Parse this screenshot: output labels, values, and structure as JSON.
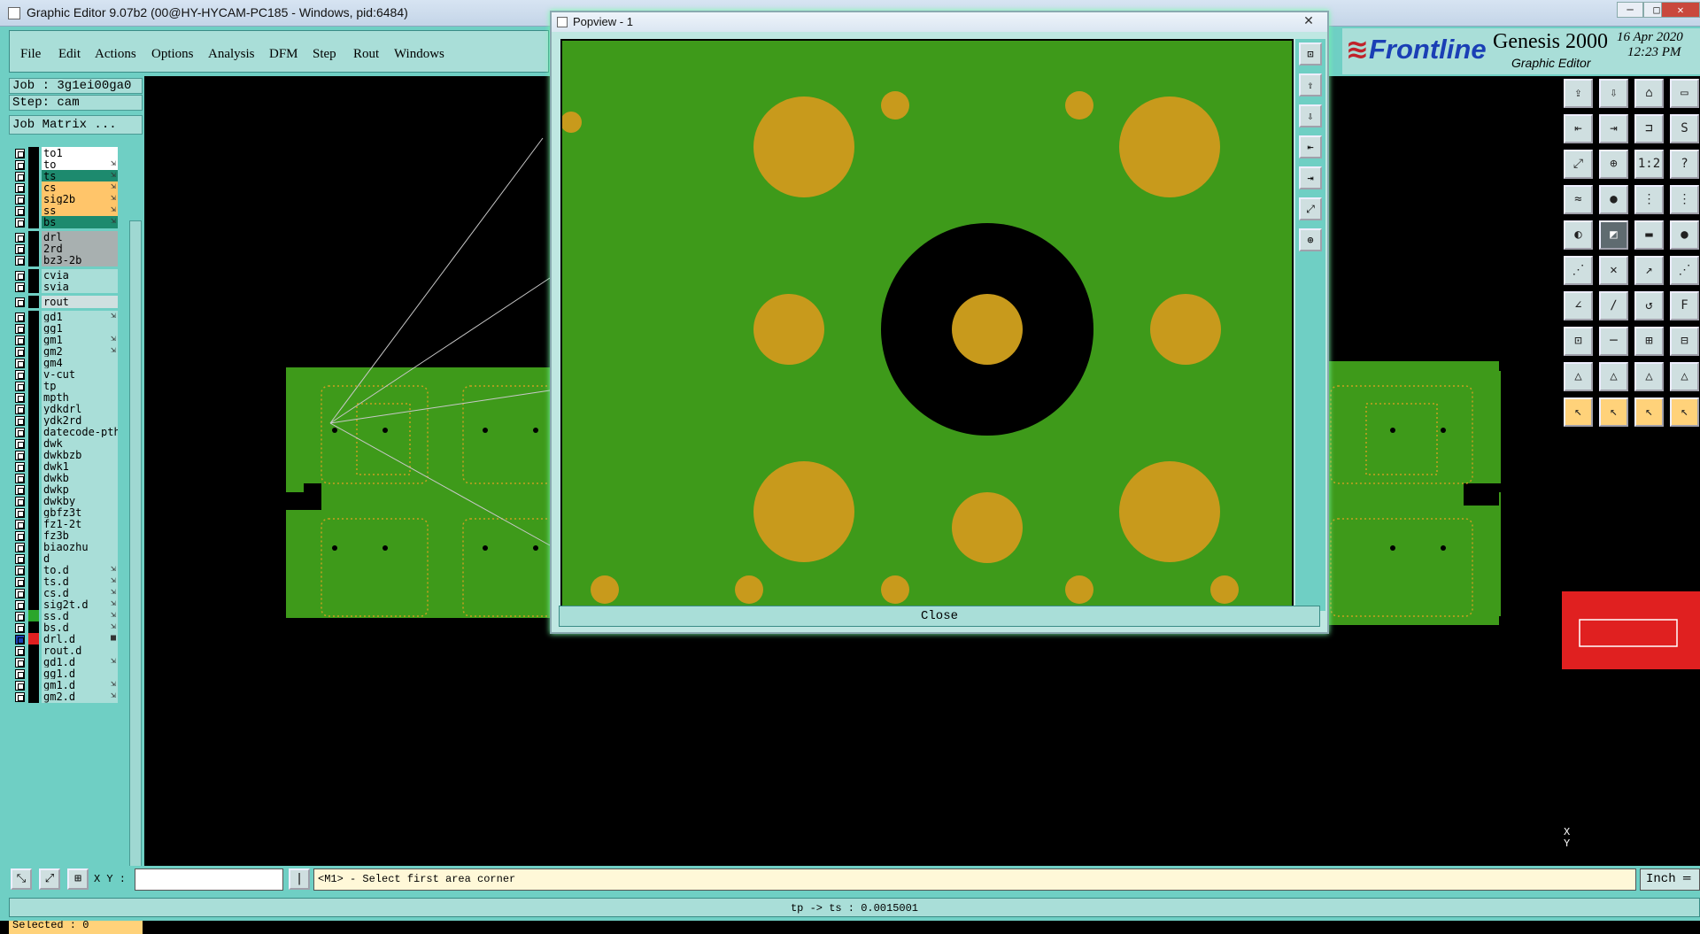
{
  "window": {
    "title": "Graphic Editor 9.07b2 (00@HY-HYCAM-PC185 - Windows, pid:6484)",
    "minimize": "─",
    "maximize": "□",
    "close": "✕"
  },
  "menu": [
    "File",
    "Edit",
    "Actions",
    "Options",
    "Analysis",
    "DFM",
    "Step",
    "Rout",
    "Windows"
  ],
  "brand": {
    "name": "Frontline",
    "product": "Genesis 2000",
    "subtitle": "Graphic Editor",
    "date": "16 Apr 2020",
    "time": "12:23 PM",
    "accent": "#1a3fb5",
    "mark_color": "#c0222a"
  },
  "job": {
    "label": "Job : 3g1ei00ga0",
    "step": "Step: cam",
    "matrix_button": "Job Matrix ..."
  },
  "layers": [
    {
      "name": "to1",
      "color": "#ffffff",
      "arrow": ""
    },
    {
      "name": "to",
      "color": "#ffffff",
      "arrow": "⇲"
    },
    {
      "name": "ts",
      "color": "#1d8a6e",
      "arrow": "⇲"
    },
    {
      "name": "cs",
      "color": "#ffc56a",
      "arrow": "⇲"
    },
    {
      "name": "sig2b",
      "color": "#ffc56a",
      "arrow": "⇲"
    },
    {
      "name": "ss",
      "color": "#ffc56a",
      "arrow": "⇲"
    },
    {
      "name": "bs",
      "color": "#1d8a6e",
      "arrow": "⇲"
    },
    {
      "name": "drl",
      "color": "#a8b0b0",
      "arrow": ""
    },
    {
      "name": "2rd",
      "color": "#a8b0b0",
      "arrow": ""
    },
    {
      "name": "bz3-2b",
      "color": "#a8b0b0",
      "arrow": ""
    },
    {
      "name": "cvia",
      "color": "#a9ded8",
      "arrow": ""
    },
    {
      "name": "svia",
      "color": "#a9ded8",
      "arrow": ""
    },
    {
      "name": "rout",
      "color": "#cfe0e0",
      "arrow": ""
    },
    {
      "name": "gd1",
      "color": "#a9ded8",
      "arrow": "⇲"
    },
    {
      "name": "gg1",
      "color": "#a9ded8",
      "arrow": ""
    },
    {
      "name": "gm1",
      "color": "#a9ded8",
      "arrow": "⇲"
    },
    {
      "name": "gm2",
      "color": "#a9ded8",
      "arrow": "⇲"
    },
    {
      "name": "gm4",
      "color": "#a9ded8",
      "arrow": ""
    },
    {
      "name": "v-cut",
      "color": "#a9ded8",
      "arrow": ""
    },
    {
      "name": "tp",
      "color": "#a9ded8",
      "arrow": ""
    },
    {
      "name": "mpth",
      "color": "#a9ded8",
      "arrow": ""
    },
    {
      "name": "ydkdrl",
      "color": "#a9ded8",
      "arrow": ""
    },
    {
      "name": "ydk2rd",
      "color": "#a9ded8",
      "arrow": ""
    },
    {
      "name": "datecode-pth",
      "color": "#a9ded8",
      "arrow": ""
    },
    {
      "name": "dwk",
      "color": "#a9ded8",
      "arrow": ""
    },
    {
      "name": "dwkbzb",
      "color": "#a9ded8",
      "arrow": ""
    },
    {
      "name": "dwk1",
      "color": "#a9ded8",
      "arrow": ""
    },
    {
      "name": "dwkb",
      "color": "#a9ded8",
      "arrow": ""
    },
    {
      "name": "dwkp",
      "color": "#a9ded8",
      "arrow": ""
    },
    {
      "name": "dwkby",
      "color": "#a9ded8",
      "arrow": ""
    },
    {
      "name": "gbfz3t",
      "color": "#a9ded8",
      "arrow": ""
    },
    {
      "name": "fz1-2t",
      "color": "#a9ded8",
      "arrow": ""
    },
    {
      "name": "fz3b",
      "color": "#a9ded8",
      "arrow": ""
    },
    {
      "name": "biaozhu",
      "color": "#a9ded8",
      "arrow": ""
    },
    {
      "name": "d",
      "color": "#a9ded8",
      "arrow": ""
    },
    {
      "name": "to.d",
      "color": "#a9ded8",
      "arrow": "⇲"
    },
    {
      "name": "ts.d",
      "color": "#a9ded8",
      "arrow": "⇲"
    },
    {
      "name": "cs.d",
      "color": "#a9ded8",
      "arrow": "⇲"
    },
    {
      "name": "sig2t.d",
      "color": "#a9ded8",
      "arrow": "⇲"
    },
    {
      "name": "ss.d",
      "color": "#a9ded8",
      "arrow": "⇲"
    },
    {
      "name": "bs.d",
      "color": "#a9ded8",
      "arrow": "⇲"
    },
    {
      "name": "drl.d",
      "color": "#a9ded8",
      "arrow": "■"
    },
    {
      "name": "rout.d",
      "color": "#a9ded8",
      "arrow": ""
    },
    {
      "name": "gd1.d",
      "color": "#a9ded8",
      "arrow": "⇲"
    },
    {
      "name": "gg1.d",
      "color": "#a9ded8",
      "arrow": ""
    },
    {
      "name": "gm1.d",
      "color": "#a9ded8",
      "arrow": "⇲"
    },
    {
      "name": "gm2.d",
      "color": "#a9ded8",
      "arrow": "⇲"
    }
  ],
  "selected": "Selected : 0",
  "popview": {
    "title": "Popview - 1",
    "close_button": "Close"
  },
  "command": {
    "xy_label": "X Y :",
    "prompt": "<M1> - Select first area corner",
    "units": "Inch ═"
  },
  "status": "tp -> ts : 0.0015001",
  "coords": {
    "x_label": "X",
    "y_label": "Y"
  },
  "right_tools": [
    [
      "⇪",
      "⇩",
      "⌂",
      "▭"
    ],
    [
      "⇤",
      "⇥",
      "⊐",
      "S"
    ],
    [
      "⤢",
      "⊕",
      "1:2",
      "?"
    ],
    [
      "≈",
      "●",
      "⋮",
      "⋮"
    ],
    [
      "◐",
      "◩",
      "▬",
      "●"
    ],
    [
      "⋰",
      "✕",
      "↗",
      "⋰"
    ],
    [
      "∠",
      "∕",
      "↺",
      "F"
    ],
    [
      "⊡",
      "─",
      "⊞",
      "⊟"
    ],
    [
      "△",
      "△",
      "△",
      "△"
    ],
    [
      "↖",
      "↖",
      "↖",
      "↖"
    ]
  ],
  "popview_tools": [
    "⊡",
    "⇪",
    "⇩",
    "⇤",
    "⇥",
    "⤢",
    "⊕"
  ],
  "cmd_icons": [
    "⤡",
    "⤢",
    "⊞",
    "|"
  ]
}
